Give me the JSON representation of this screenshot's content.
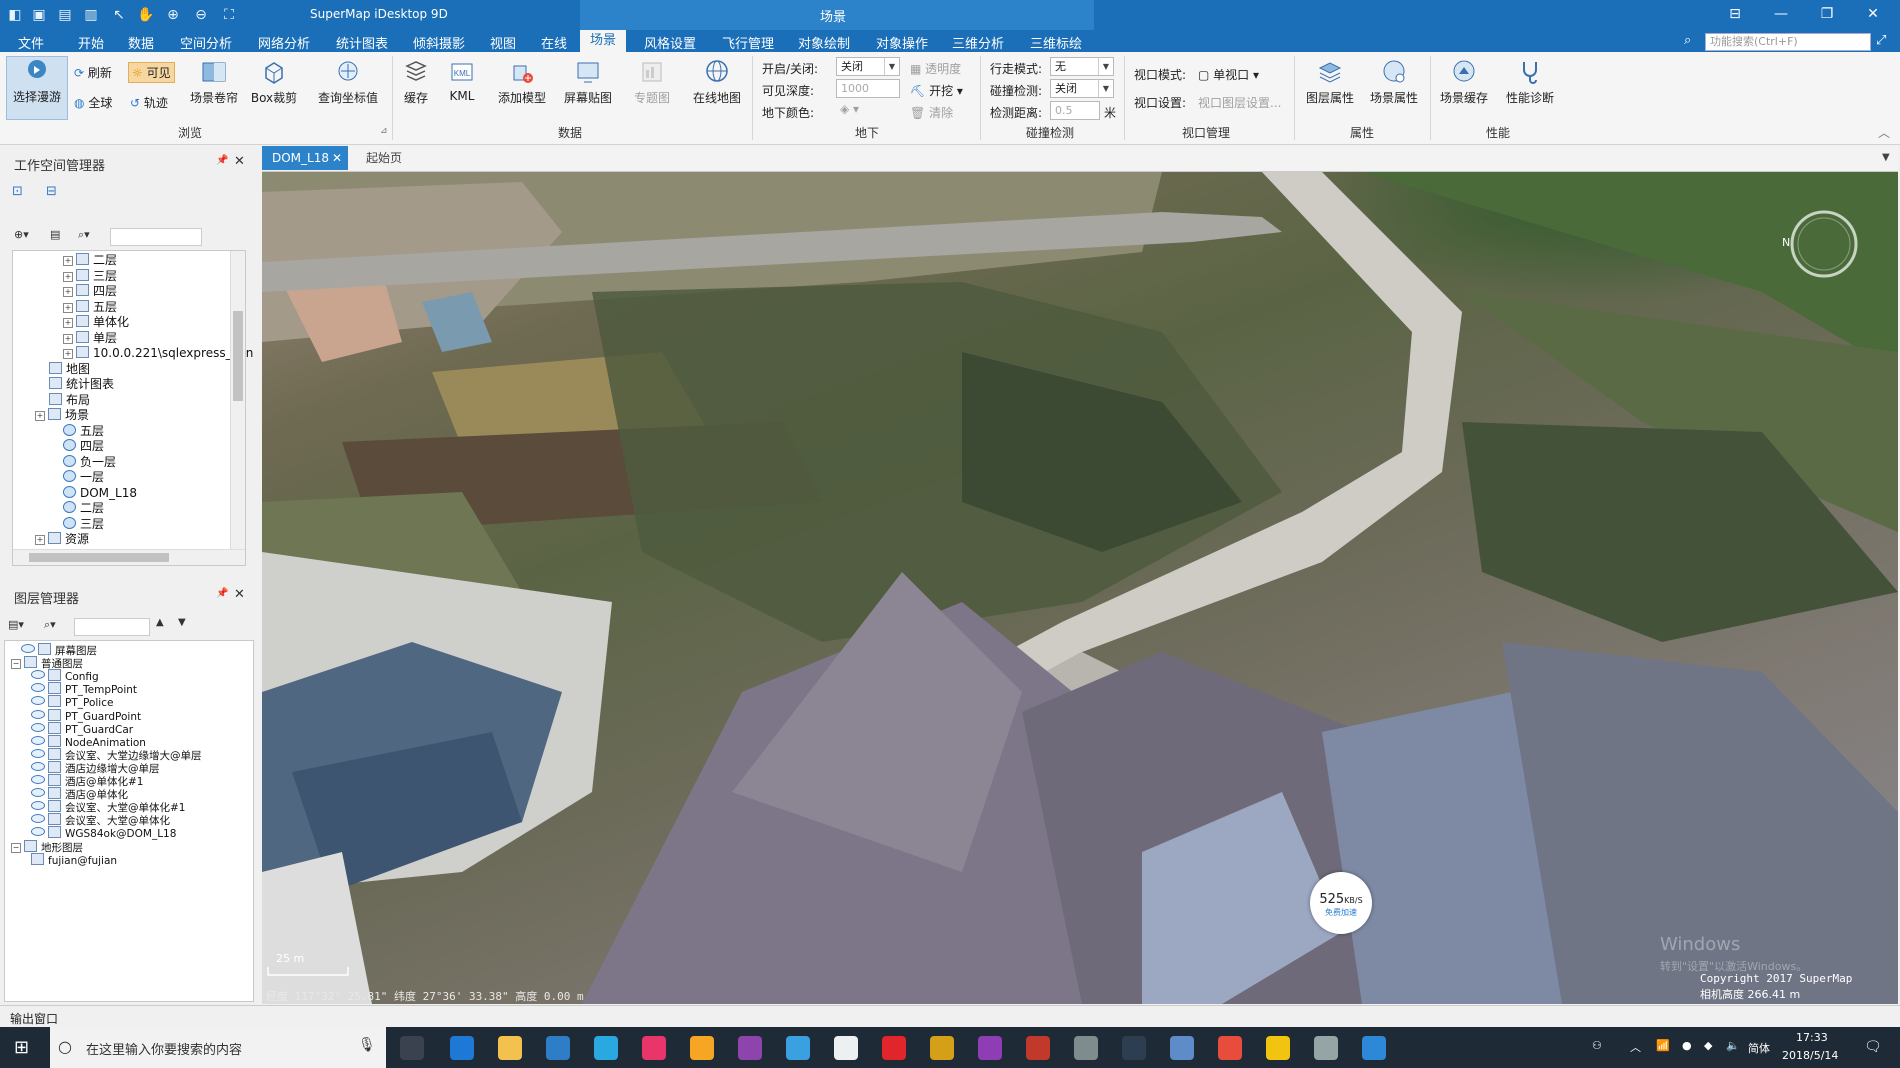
{
  "window": {
    "app_title": "SuperMap iDesktop 9D",
    "context_title": "场景"
  },
  "search": {
    "placeholder": "功能搜索(Ctrl+F)"
  },
  "menu": [
    "文件",
    "开始",
    "数据",
    "空间分析",
    "网络分析",
    "统计图表",
    "倾斜摄影",
    "视图",
    "在线",
    "场景",
    "风格设置",
    "飞行管理",
    "对象绘制",
    "对象操作",
    "三维分析",
    "三维标绘"
  ],
  "menu_active": "场景",
  "ribbon": {
    "browse": {
      "label": "浏览",
      "select_roam": "选择漫游",
      "refresh": "刷新",
      "visible": "可见",
      "full": "全球",
      "track": "轨迹",
      "scene_roll": "场景卷帘",
      "box_clip": "Box裁剪",
      "query_coord": "查询坐标值"
    },
    "data": {
      "label": "数据",
      "cache": "缓存",
      "kml": "KML",
      "add_model": "添加模型",
      "screen_paste": "屏幕贴图",
      "thematic": "专题图",
      "online_map": "在线地图"
    },
    "underground": {
      "label": "地下",
      "on_off_label": "开启/关闭:",
      "on_off_value": "关闭",
      "depth_label": "可见深度:",
      "depth_value": "1000",
      "color_label": "地下颜色:",
      "transparency": "透明度",
      "dig": "开挖",
      "clear": "清除"
    },
    "collision": {
      "label": "碰撞检测",
      "walk_mode_label": "行走模式:",
      "walk_mode_value": "无",
      "collision_label": "碰撞检测:",
      "collision_value": "关闭",
      "distance_label": "检测距离:",
      "distance_value": "0.5",
      "distance_unit": "米"
    },
    "viewport": {
      "label": "视口管理",
      "mode_label": "视口模式:",
      "mode_value": "单视口",
      "setting_label": "视口设置:",
      "setting_value": "视口图层设置..."
    },
    "properties": {
      "label": "属性",
      "layer_prop": "图层属性",
      "scene_prop": "场景属性"
    },
    "performance": {
      "label": "性能",
      "scene_cache": "场景缓存",
      "perf_diag": "性能诊断"
    }
  },
  "workspace": {
    "title": "工作空间管理器",
    "items": [
      {
        "label": "二层",
        "indent": 3,
        "exp": true
      },
      {
        "label": "三层",
        "indent": 3,
        "exp": true
      },
      {
        "label": "四层",
        "indent": 3,
        "exp": true
      },
      {
        "label": "五层",
        "indent": 3,
        "exp": true
      },
      {
        "label": "单体化",
        "indent": 3,
        "exp": true
      },
      {
        "label": "单层",
        "indent": 3,
        "exp": true
      },
      {
        "label": "10.0.0.221\\sqlexpress_Join",
        "indent": 3,
        "exp": true
      },
      {
        "label": "地图",
        "indent": 2,
        "exp": false
      },
      {
        "label": "统计图表",
        "indent": 2,
        "exp": false
      },
      {
        "label": "布局",
        "indent": 2,
        "exp": false
      },
      {
        "label": "场景",
        "indent": 1,
        "exp": true
      },
      {
        "label": "五层",
        "indent": 3,
        "exp": false,
        "globe": true
      },
      {
        "label": "四层",
        "indent": 3,
        "exp": false,
        "globe": true
      },
      {
        "label": "负一层",
        "indent": 3,
        "exp": false,
        "globe": true
      },
      {
        "label": "一层",
        "indent": 3,
        "exp": false,
        "globe": true
      },
      {
        "label": "DOM_L18",
        "indent": 3,
        "exp": false,
        "globe": true
      },
      {
        "label": "二层",
        "indent": 3,
        "exp": false,
        "globe": true
      },
      {
        "label": "三层",
        "indent": 3,
        "exp": false,
        "globe": true
      },
      {
        "label": "资源",
        "indent": 1,
        "exp": true
      }
    ]
  },
  "layers": {
    "title": "图层管理器",
    "items": [
      {
        "label": "屏幕图层",
        "indent": 1,
        "eye": true
      },
      {
        "label": "普通图层",
        "indent": 0,
        "eye": false,
        "exp": true
      },
      {
        "label": "Config",
        "indent": 2,
        "eye": true
      },
      {
        "label": "PT_TempPoint",
        "indent": 2,
        "eye": true
      },
      {
        "label": "PT_Police",
        "indent": 2,
        "eye": true
      },
      {
        "label": "PT_GuardPoint",
        "indent": 2,
        "eye": true
      },
      {
        "label": "PT_GuardCar",
        "indent": 2,
        "eye": true
      },
      {
        "label": "NodeAnimation",
        "indent": 2,
        "eye": true
      },
      {
        "label": "会议室、大堂边缘增大@单层",
        "indent": 2,
        "eye": true
      },
      {
        "label": "酒店边缘增大@单层",
        "indent": 2,
        "eye": true
      },
      {
        "label": "酒店@单体化#1",
        "indent": 2,
        "eye": true
      },
      {
        "label": "酒店@单体化",
        "indent": 2,
        "eye": true
      },
      {
        "label": "会议室、大堂@单体化#1",
        "indent": 2,
        "eye": true
      },
      {
        "label": "会议室、大堂@单体化",
        "indent": 2,
        "eye": true
      },
      {
        "label": "WGS84ok@DOM_L18",
        "indent": 2,
        "eye": true
      },
      {
        "label": "地形图层",
        "indent": 0,
        "eye": false,
        "exp": true
      },
      {
        "label": "fujian@fujian",
        "indent": 2,
        "eye": false
      }
    ]
  },
  "doc_tabs": [
    "DOM_L18",
    "起始页"
  ],
  "scene": {
    "scale_label": "25 m",
    "status": "经度 117°32' 25.81\"  纬度 27°36' 33.38\"  高度 0.00 m",
    "copyright": "Copyright 2017 SuperMap",
    "camera_height": "相机高度 266.41 m",
    "net_speed": "525",
    "net_unit": "KB/S",
    "net_note": "免费加速",
    "watermark1": "Windows",
    "watermark2": "转到\"设置\"以激活Windows。"
  },
  "output": {
    "label": "输出窗口"
  },
  "taskbar": {
    "search_text": "在这里输入你要搜索的内容",
    "time": "17:33",
    "date": "2018/5/14",
    "ime": "简体"
  },
  "colors": {
    "titlebar": "#1b6fb8",
    "context": "#2c83c9",
    "taskbar": "#1e2a36"
  }
}
